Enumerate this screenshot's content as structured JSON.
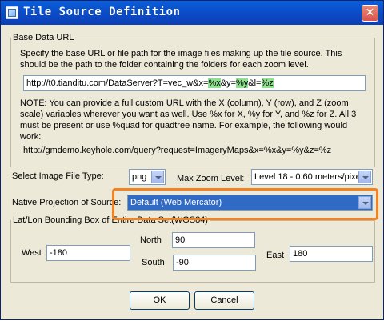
{
  "window": {
    "title": "Tile Source Definition"
  },
  "base_data": {
    "legend": "Base Data URL",
    "description": "Specify the base URL or file path for the image files making up the tile source. This should be the path to the folder containing the folders for each zoom level.",
    "url_parts": [
      {
        "text": "http://t0.tianditu.com/DataServer?T=vec_w&x=",
        "hl": false
      },
      {
        "text": "%x",
        "hl": true
      },
      {
        "text": "&y=",
        "hl": false
      },
      {
        "text": "%y",
        "hl": true
      },
      {
        "text": "&l=",
        "hl": false
      },
      {
        "text": "%z",
        "hl": true
      }
    ],
    "note": "NOTE: You can provide a full custom URL with the X (column), Y (row), and Z (zoom scale) variables wherever you want as well. Use %x for X, %y for Y, and %z for Z. All 3 must be present or use %quad for quadtree name. For example, the following would work:",
    "example": "http://gmdemo.keyhole.com/query?request=ImageryMaps&x=%x&y=%y&z=%z"
  },
  "image_file_type": {
    "label": "Select Image File Type:",
    "value": "png"
  },
  "max_zoom": {
    "label": "Max Zoom Level:",
    "value": "Level 18 - 0.60 meters/pixe"
  },
  "projection": {
    "label": "Native Projection of Source:",
    "value": "Default (Web Mercator)"
  },
  "bbox": {
    "legend": "Lat/Lon Bounding Box of Entire Data Set(WGS84)",
    "north_label": "North",
    "north": "90",
    "south_label": "South",
    "south": "-90",
    "west_label": "West",
    "west": "-180",
    "east_label": "East",
    "east": "180"
  },
  "buttons": {
    "ok": "OK",
    "cancel": "Cancel"
  },
  "colors": {
    "titlebar": "#0b4cc8",
    "highlight": "#f58220",
    "selection": "#316ac5",
    "placeholder_green": "#8fe08f"
  }
}
